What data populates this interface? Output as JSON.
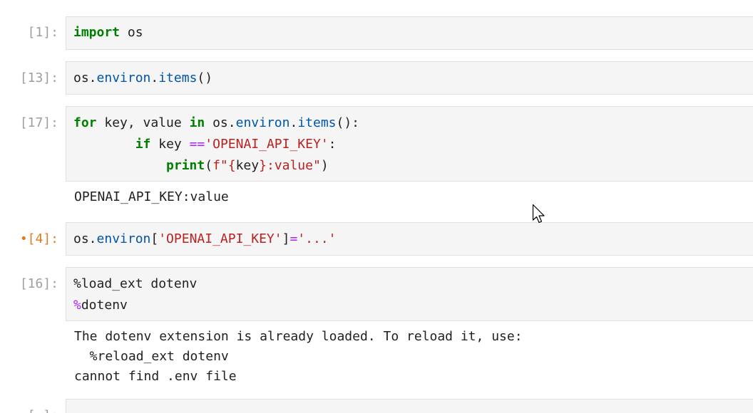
{
  "cells": [
    {
      "prompt": "[1]:",
      "code": [
        [
          {
            "t": "import",
            "c": "kw"
          },
          {
            "t": " os",
            "c": ""
          }
        ]
      ]
    },
    {
      "prompt": "[13]:",
      "code": [
        [
          {
            "t": "os.",
            "c": ""
          },
          {
            "t": "environ",
            "c": "nm"
          },
          {
            "t": ".",
            "c": ""
          },
          {
            "t": "items",
            "c": "nm"
          },
          {
            "t": "()",
            "c": ""
          }
        ]
      ]
    },
    {
      "prompt": "[17]:",
      "code": [
        [
          {
            "t": "for",
            "c": "kw"
          },
          {
            "t": " key, value ",
            "c": ""
          },
          {
            "t": "in",
            "c": "kw"
          },
          {
            "t": " os.",
            "c": ""
          },
          {
            "t": "environ",
            "c": "nm"
          },
          {
            "t": ".",
            "c": ""
          },
          {
            "t": "items",
            "c": "nm"
          },
          {
            "t": "():",
            "c": ""
          }
        ],
        [
          {
            "t": "        ",
            "c": ""
          },
          {
            "t": "if",
            "c": "kw"
          },
          {
            "t": " key ",
            "c": ""
          },
          {
            "t": "==",
            "c": "op"
          },
          {
            "t": "'OPENAI_API_KEY'",
            "c": "st"
          },
          {
            "t": ":",
            "c": ""
          }
        ],
        [
          {
            "t": "            ",
            "c": ""
          },
          {
            "t": "print",
            "c": "kw"
          },
          {
            "t": "(",
            "c": ""
          },
          {
            "t": "f\"{",
            "c": "st"
          },
          {
            "t": "key",
            "c": ""
          },
          {
            "t": "}",
            "c": "st"
          },
          {
            "t": ":value\"",
            "c": "st"
          },
          {
            "t": ")",
            "c": ""
          }
        ]
      ],
      "output": "OPENAI_API_KEY:value"
    },
    {
      "prompt": "•[4]:",
      "code": [
        [
          {
            "t": "os.",
            "c": ""
          },
          {
            "t": "environ",
            "c": "nm"
          },
          {
            "t": "[",
            "c": ""
          },
          {
            "t": "'OPENAI_API_KEY'",
            "c": "st"
          },
          {
            "t": "]",
            "c": ""
          },
          {
            "t": "=",
            "c": "op"
          },
          {
            "t": "'...'",
            "c": "st"
          }
        ]
      ]
    },
    {
      "prompt": "[16]:",
      "code": [
        [
          {
            "t": "%load_ext dotenv",
            "c": ""
          }
        ],
        [
          {
            "t": "%",
            "c": "mg"
          },
          {
            "t": "dotenv",
            "c": ""
          }
        ]
      ],
      "output": "The dotenv extension is already loaded. To reload it, use:\n  %reload_ext dotenv\ncannot find .env file"
    },
    {
      "prompt": "[ ]:",
      "code": [
        [
          {
            "t": "",
            "c": ""
          }
        ]
      ]
    }
  ]
}
